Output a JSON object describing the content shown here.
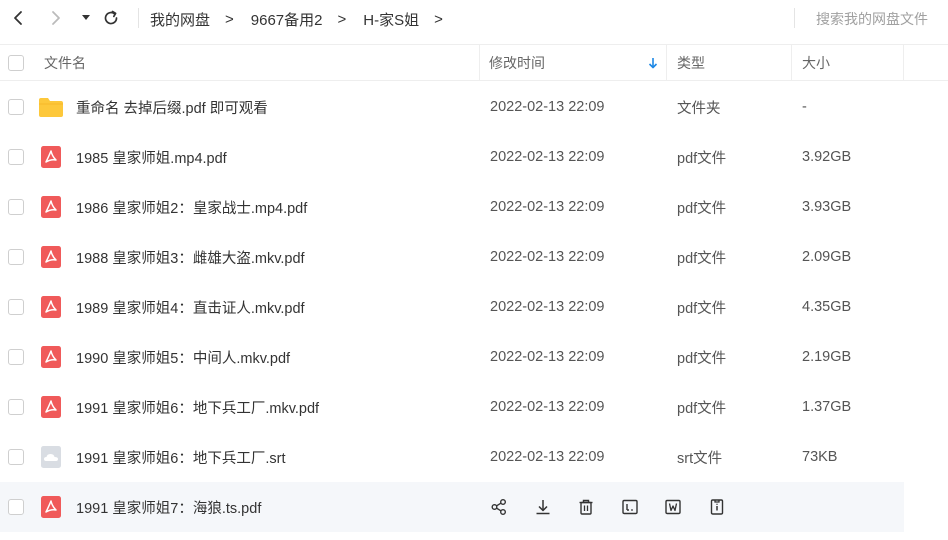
{
  "nav": {
    "breadcrumbs": [
      "我的网盘",
      "9667备用2",
      "H-家S姐"
    ],
    "crumb_separator": ">",
    "search_placeholder": "搜索我的网盘文件"
  },
  "header": {
    "name": "文件名",
    "time": "修改时间",
    "type": "类型",
    "size": "大小"
  },
  "colors": {
    "pdf_red": "#f05a5a",
    "folder_yellow": "#fdc83b",
    "sort_arrow_blue": "#1e88e5",
    "hover_row": "#f5f7fa"
  },
  "rows": [
    {
      "icon": "folder-icon",
      "name": "重命名 去掉后缀.pdf 即可观看",
      "time": "2022-02-13 22:09",
      "type": "文件夹",
      "size": "-"
    },
    {
      "icon": "pdf-icon",
      "name": "1985 皇家师姐.mp4.pdf",
      "time": "2022-02-13 22:09",
      "type": "pdf文件",
      "size": "3.92GB"
    },
    {
      "icon": "pdf-icon",
      "name": "1986 皇家师姐2：皇家战士.mp4.pdf",
      "time": "2022-02-13 22:09",
      "type": "pdf文件",
      "size": "3.93GB"
    },
    {
      "icon": "pdf-icon",
      "name": "1988 皇家师姐3：雌雄大盗.mkv.pdf",
      "time": "2022-02-13 22:09",
      "type": "pdf文件",
      "size": "2.09GB"
    },
    {
      "icon": "pdf-icon",
      "name": "1989 皇家师姐4：直击证人.mkv.pdf",
      "time": "2022-02-13 22:09",
      "type": "pdf文件",
      "size": "4.35GB"
    },
    {
      "icon": "pdf-icon",
      "name": "1990 皇家师姐5：中间人.mkv.pdf",
      "time": "2022-02-13 22:09",
      "type": "pdf文件",
      "size": "2.19GB"
    },
    {
      "icon": "pdf-icon",
      "name": "1991 皇家师姐6：地下兵工厂.mkv.pdf",
      "time": "2022-02-13 22:09",
      "type": "pdf文件",
      "size": "1.37GB"
    },
    {
      "icon": "cloud-file-icon",
      "name": "1991 皇家师姐6：地下兵工厂.srt",
      "time": "2022-02-13 22:09",
      "type": "srt文件",
      "size": "73KB"
    },
    {
      "icon": "pdf-icon",
      "name": "1991 皇家师姐7：海狼.ts.pdf"
    }
  ],
  "row_actions": [
    "share-icon",
    "download-icon",
    "delete-icon",
    "rename-icon",
    "copy-icon",
    "info-icon"
  ]
}
